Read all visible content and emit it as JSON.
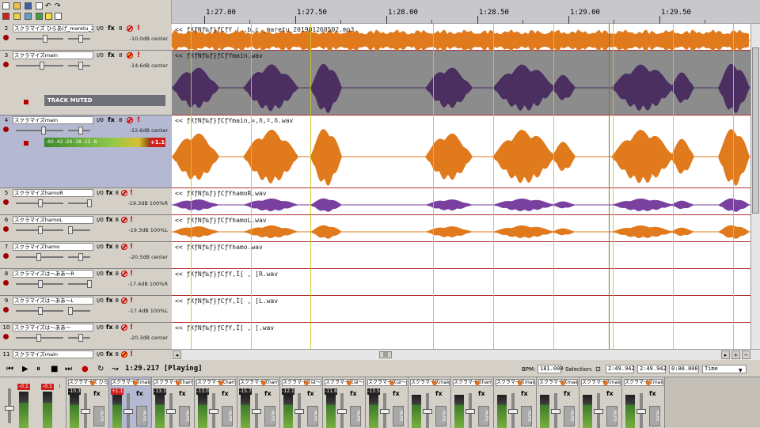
{
  "ruler": {
    "labels": [
      "1:27.00",
      "1:27.50",
      "1:28.00",
      "1:28.50",
      "1:29.00",
      "1:29.50"
    ]
  },
  "tracks": [
    {
      "num": "2",
      "name": "スクラマイズ ひらあげ_maretu_20",
      "info": "-10.0dB center",
      "selected": false
    },
    {
      "num": "3",
      "name": "スクラマイズmain",
      "info": "-14.6dB center",
      "selected": false,
      "muted_label": "TRACK MUTED"
    },
    {
      "num": "4",
      "name": "スクラマイズmain",
      "info": "-12.6dB center",
      "selected": true,
      "meter_peak": "+1.1",
      "meter_scale": "-60 -42 -24 -18 -12 -6"
    },
    {
      "num": "5",
      "name": "スクラマイズhamoR",
      "info": "-19.3dB 100%R",
      "selected": false
    },
    {
      "num": "6",
      "name": "スクラマイズhamoL",
      "info": "-19.3dB 100%L",
      "selected": false
    },
    {
      "num": "7",
      "name": "スクラマイズhamo",
      "info": "-20.5dB center",
      "selected": false
    },
    {
      "num": "8",
      "name": "スクラマイズは～ああ～R",
      "info": "-17.4dB 100%R",
      "selected": false
    },
    {
      "num": "9",
      "name": "スクラマイズは～ああ～L",
      "info": "-17.4dB 100%L",
      "selected": false
    },
    {
      "num": "10",
      "name": "スクラマイズは～ああ～",
      "info": "-20.3dB center",
      "selected": false
    },
    {
      "num": "11",
      "name": "スクラマイズmain",
      "info": "",
      "selected": false
    }
  ],
  "track_buttons": {
    "io": "I/0",
    "fx": "fx",
    "phase": "8",
    "solo": "!"
  },
  "lanes": [
    {
      "label": "<< ƒXƒNƒ‰ƒ}ƒCƒY ( ,b,c  _maretu_201901260502.mp3",
      "color": "#e07a1c"
    },
    {
      "label": "<< ƒXƒNƒ‰ƒ}ƒCƒYmain.wav",
      "color": "#4a2f60"
    },
    {
      "label": "<< ƒXƒNƒ‰ƒ}ƒCƒYmain,¤,ñ,º,ñ.wav",
      "color": "#e07a1c"
    },
    {
      "label": "<< ƒXƒNƒ‰ƒ}ƒCƒYhamoR.wav",
      "color": "#7a40a0"
    },
    {
      "label": "<< ƒXƒNƒ‰ƒ}ƒCƒYhamoL.wav",
      "color": "#e07a1c"
    },
    {
      "label": "<< ƒXƒNƒ‰ƒ}ƒCƒYhamo.wav",
      "color": "#e07a1c"
    },
    {
      "label": "<< ƒXƒNƒ‰ƒ}ƒCƒY,Í[ , [R.wav",
      "color": "#e07a1c"
    },
    {
      "label": "<< ƒXƒNƒ‰ƒ}ƒCƒY,Í[ , [L.wav",
      "color": "#e07a1c"
    },
    {
      "label": "<< ƒXƒNƒ‰ƒ}ƒCƒY,Í[ , [.wav",
      "color": "#e07a1c"
    }
  ],
  "transport": {
    "time": "1:29.217 [Playing]",
    "bpm_label": "BPM:",
    "bpm": "181.000",
    "selection_label": "Selection:",
    "sel_start": "2:49.942",
    "sel_end": "2:49.942",
    "sel_len": "0:00.000",
    "time_mode": "Time"
  },
  "mixer": {
    "master": {
      "peak_l": "-0.1",
      "peak_r": "-0.1"
    },
    "strips": [
      {
        "name": "スクラマイズ ひら",
        "peak": "-10.3",
        "fx": "fx",
        "mute": "MUTE"
      },
      {
        "name": "スクラマイズmain",
        "peak": "+1.1",
        "fx": "fx",
        "mute": "MUTE"
      },
      {
        "name": "スクラマイズhamo",
        "peak": "-13.3",
        "fx": "fx",
        "mute": "MUTE"
      },
      {
        "name": "スクラマイズhamo",
        "peak": "-13.0",
        "fx": "fx",
        "mute": "MUTE"
      },
      {
        "name": "スクラマイズhamo",
        "peak": "-15.7",
        "fx": "fx",
        "mute": "MUTE"
      },
      {
        "name": "スクラマイズは～a",
        "peak": "-12.1",
        "fx": "fx",
        "mute": "MUTE"
      },
      {
        "name": "スクラマイズは～a",
        "peak": "-11.8",
        "fx": "fx",
        "mute": "MUTE"
      },
      {
        "name": "スクラマイズは～a",
        "peak": "-13.5",
        "fx": "fx",
        "mute": "MUTE"
      },
      {
        "name": "スクラマイズmain",
        "peak": "",
        "fx": "fx",
        "mute": "MUTE"
      },
      {
        "name": "スクラマイズhamo",
        "peak": "",
        "fx": "fx",
        "mute": "MUTE"
      },
      {
        "name": "スクラマイズmain",
        "peak": "",
        "fx": "fx",
        "mute": "MUTE"
      },
      {
        "name": "スクラマイズmain",
        "peak": "",
        "fx": "fx",
        "mute": "MUTE"
      },
      {
        "name": "スクラマイズmain",
        "peak": "",
        "fx": "fx",
        "mute": "MUTE"
      },
      {
        "name": "スクラマイズmain",
        "peak": "",
        "fx": "fx",
        "mute": "MUTE"
      }
    ]
  }
}
